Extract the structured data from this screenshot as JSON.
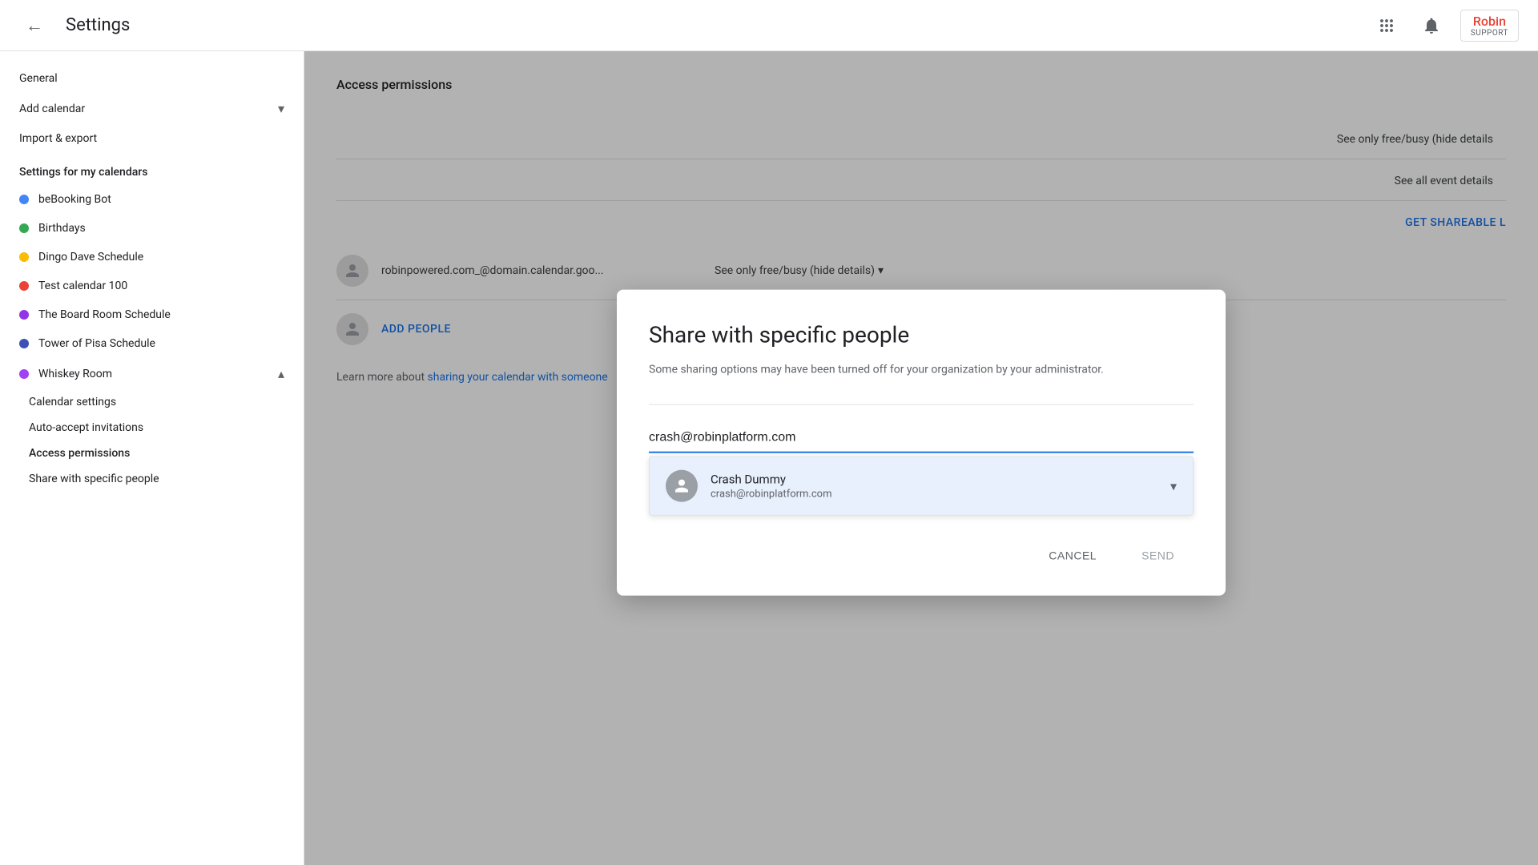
{
  "header": {
    "back_label": "←",
    "title": "Settings",
    "apps_icon": "⊞",
    "notifications_icon": "🔔",
    "robin_name": "Robin",
    "robin_sub": "SUPPORT"
  },
  "sidebar": {
    "general_label": "General",
    "add_calendar_label": "Add calendar",
    "import_export_label": "Import & export",
    "my_calendars_label": "Settings for my calendars",
    "calendars": [
      {
        "name": "beBooking Bot",
        "dot_class": "dot-blue"
      },
      {
        "name": "Birthdays",
        "dot_class": "dot-green"
      },
      {
        "name": "Dingo Dave Schedule",
        "dot_class": "dot-yellow"
      },
      {
        "name": "Test calendar 100",
        "dot_class": "dot-red"
      },
      {
        "name": "The Board Room Schedule",
        "dot_class": "dot-purple"
      },
      {
        "name": "Tower of Pisa Schedule",
        "dot_class": "dot-indigo"
      }
    ],
    "whiskey_room_label": "Whiskey Room",
    "whiskey_sub_items": [
      {
        "name": "Calendar settings"
      },
      {
        "name": "Auto-accept invitations"
      },
      {
        "name": "Access permissions",
        "bold": true
      },
      {
        "name": "Share with specific people"
      }
    ]
  },
  "access_panel": {
    "title": "Access permissions",
    "see_free_busy_label": "See only free/busy (hide details",
    "see_all_label": "See all event details",
    "get_shareable_label": "GET SHAREABLE L",
    "resource_email": "robinpowered.com_@domain.calendar.goo...",
    "resource_permission": "See only free/busy (hide details)",
    "add_people_label": "ADD PEOPLE",
    "learn_more_prefix": "Learn more about ",
    "learn_more_link": "sharing your calendar with someone"
  },
  "modal": {
    "title": "Share with specific people",
    "subtitle": "Some sharing options may have been turned off for your organization by your administrator.",
    "input_value": "crash@robinplatform.com",
    "suggestion": {
      "name": "Crash Dummy",
      "email": "crash@robinplatform.com"
    },
    "cancel_label": "CANCEL",
    "send_label": "SEND"
  }
}
